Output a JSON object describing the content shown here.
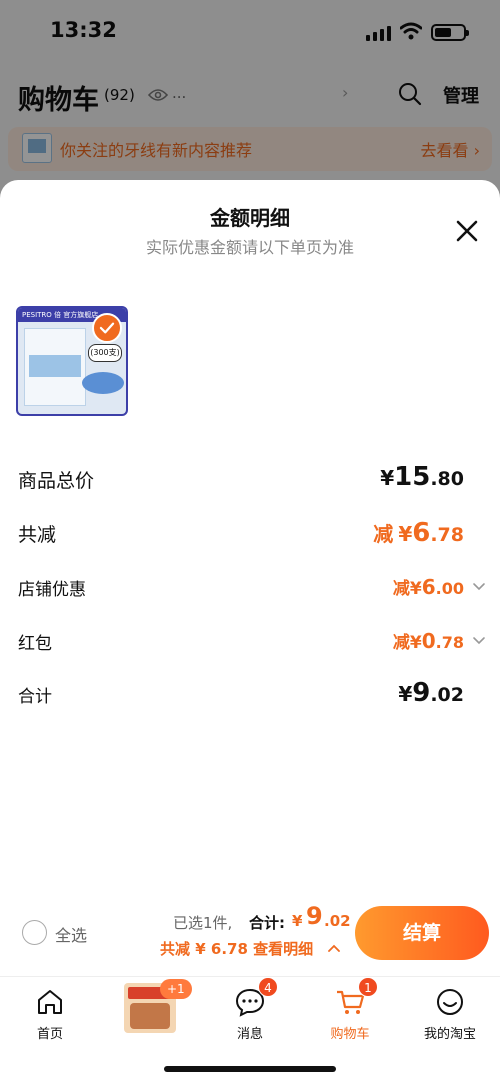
{
  "status_bar": {
    "time": "13:32"
  },
  "cart_header": {
    "title": "购物车",
    "count": "(92)",
    "dots": "...",
    "manage_label": "管理"
  },
  "notice": {
    "text": "你关注的牙线有新内容推荐",
    "link": "去看看 ›"
  },
  "sheet": {
    "title": "金额明细",
    "subtitle": "实际优惠金额请以下单页为准"
  },
  "rows": {
    "total_price": {
      "label": "商品总价",
      "yen": "¥",
      "int": "15",
      "dec": ".80"
    },
    "total_reduce": {
      "label": "共减",
      "prefix": "减",
      "yen": "¥",
      "int": "6",
      "dec": ".78"
    },
    "store_discount": {
      "label": "店铺优惠",
      "prefix": "减",
      "yen": "¥",
      "int": "6",
      "dec": ".00"
    },
    "red_packet": {
      "label": "红包",
      "prefix": "减",
      "yen": "¥",
      "int": "0",
      "dec": ".78"
    },
    "sum": {
      "label": "合计",
      "yen": "¥",
      "int": "9",
      "dec": ".02"
    }
  },
  "product": {
    "brand_strip": "PESITRO 倍 官方旗舰店",
    "pack_label": "(300支)"
  },
  "checkout": {
    "select_all": "全选",
    "selected": "已选1件,",
    "total_label": "合计:",
    "total_yen": "¥",
    "total_int": "9",
    "total_dec": ".02",
    "discount_link": "共减 ¥ 6.78  查看明细",
    "button": "结算"
  },
  "tabs": {
    "home": "首页",
    "promo_badge": "+1",
    "messages": "消息",
    "messages_badge": "4",
    "cart": "购物车",
    "cart_badge": "1",
    "mine": "我的淘宝"
  },
  "colors": {
    "accent": "#f06a1f",
    "button_start": "#ff9a2e",
    "button_end": "#ff5a1f"
  }
}
